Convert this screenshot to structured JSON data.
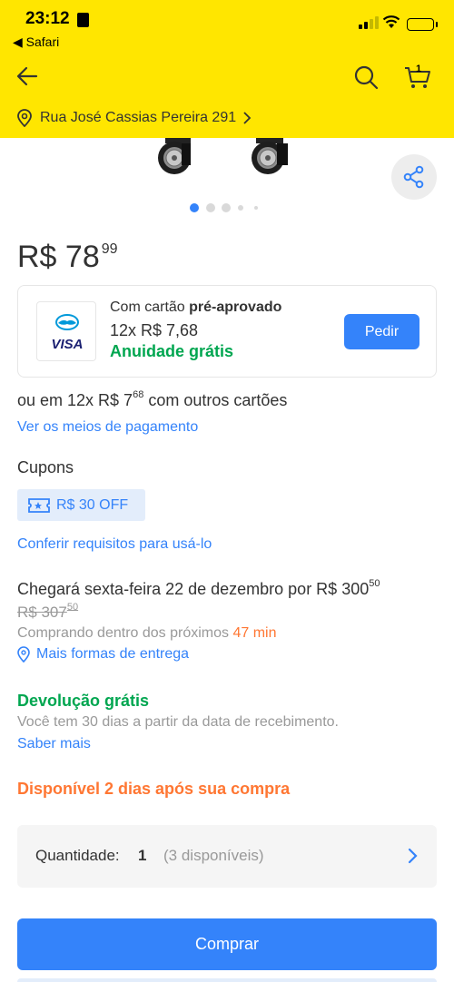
{
  "status_bar": {
    "time": "23:12",
    "back_app": "◀ Safari"
  },
  "header": {
    "cart_count": "1",
    "address": "Rua José Cassias Pereira 291"
  },
  "carousel": {
    "total": 5,
    "active_index": 0
  },
  "price": {
    "main": "R$ 78",
    "cents": "99"
  },
  "card_offer": {
    "line1_prefix": "Com cartão ",
    "line1_bold": "pré-aprovado",
    "installments": "12x R$ 7,68",
    "annuity": "Anuidade grátis",
    "brand": "VISA",
    "button_label": "Pedir"
  },
  "other_cards": {
    "prefix": "ou em 12x R$ 7",
    "cents": "68",
    "suffix": " com outros cartões"
  },
  "payment_link": "Ver os meios de pagamento",
  "coupons": {
    "title": "Cupons",
    "badge": "R$ 30 OFF",
    "link": "Conferir requisitos para usá-lo"
  },
  "delivery": {
    "line_prefix": "Chegará sexta-feira 22 de dezembro por R$ 300",
    "line_cents": "50",
    "old_price": "R$ 307",
    "old_cents": "50",
    "buying_prefix": "Comprando dentro dos próximos ",
    "buying_time": "47 min",
    "more_options": "Mais formas de entrega"
  },
  "returns": {
    "title": "Devolução grátis",
    "description": "Você tem 30 dias a partir da data de recebimento.",
    "link": "Saber mais"
  },
  "availability": "Disponível 2 dias após sua compra",
  "quantity": {
    "label": "Quantidade:",
    "value": "1",
    "available": "(3 disponíveis)"
  },
  "buy_button": "Comprar",
  "colors": {
    "header": "#ffe600",
    "primary": "#3483fa",
    "success": "#00a650",
    "warning": "#ff7733"
  }
}
